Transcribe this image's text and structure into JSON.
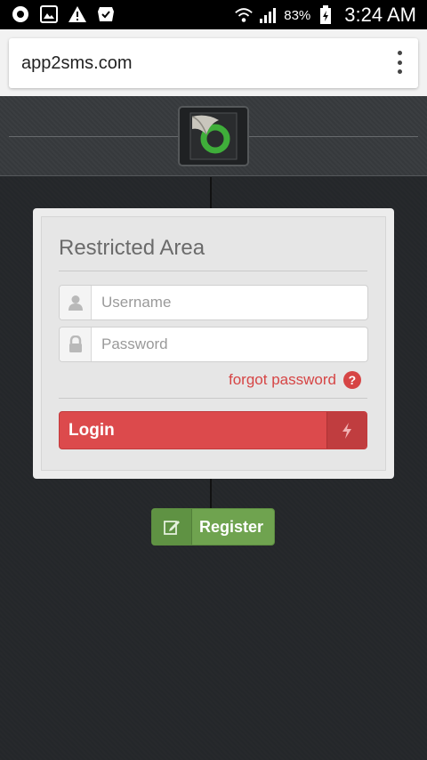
{
  "status_bar": {
    "battery_percent": "83%",
    "time": "3:24 AM",
    "left_icons": [
      "opera-icon",
      "image-icon",
      "warning-icon",
      "check-shield-icon"
    ],
    "right_icons": [
      "wifi-icon",
      "signal-icon",
      "battery-icon"
    ]
  },
  "browser": {
    "url": "app2sms.com",
    "menu_icon": "overflow-menu-icon"
  },
  "header": {
    "logo_icon": "app2sms-logo-icon"
  },
  "login_card": {
    "title": "Restricted Area",
    "username_placeholder": "Username",
    "password_placeholder": "Password",
    "forgot_label": "forgot password",
    "login_label": "Login"
  },
  "register": {
    "label": "Register"
  },
  "colors": {
    "login": "#dc4a4c",
    "register": "#6fa34f",
    "link": "#d64545",
    "background": "#272a2d"
  }
}
